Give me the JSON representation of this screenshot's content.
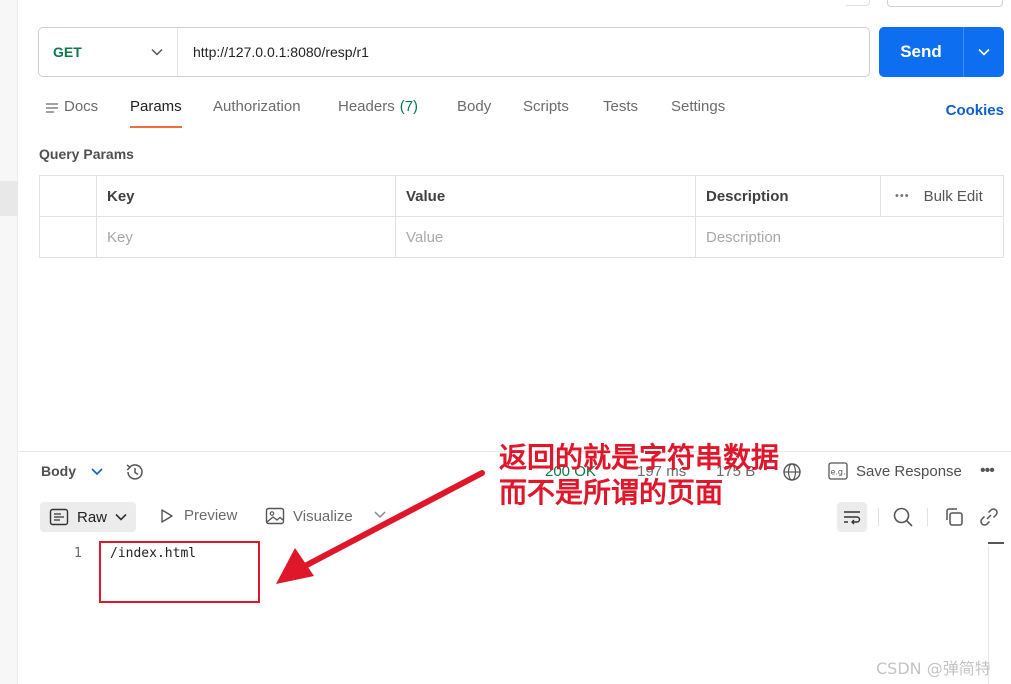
{
  "request": {
    "method": "GET",
    "url": "http://127.0.0.1:8080/resp/r1",
    "send_label": "Send"
  },
  "tabs": {
    "docs": "Docs",
    "params": "Params",
    "authorization": "Authorization",
    "headers": "Headers",
    "headers_count": "(7)",
    "body": "Body",
    "scripts": "Scripts",
    "tests": "Tests",
    "settings": "Settings",
    "active": "Params",
    "cookies": "Cookies"
  },
  "query_params": {
    "title": "Query Params",
    "columns": [
      "Key",
      "Value",
      "Description"
    ],
    "placeholders": [
      "Key",
      "Value",
      "Description"
    ],
    "bulk_edit": "Bulk Edit"
  },
  "response": {
    "body_label": "Body",
    "status": "200 OK",
    "time": "197 ms",
    "size": "175 B",
    "save_response": "Save Response",
    "view_modes": {
      "raw": "Raw",
      "preview": "Preview",
      "visualize": "Visualize"
    },
    "lines": [
      {
        "number": "1",
        "text": "/index.html"
      }
    ]
  },
  "annotation": {
    "line1": "返回的就是字符串数据",
    "line2": "而不是所谓的页面",
    "color": "#e0162b"
  },
  "watermark": "CSDN @弹简特",
  "colors": {
    "accent": "#0d6ef0",
    "method_get": "#0b7a4b",
    "active_tab_underline": "#f26b3a",
    "status_ok": "#0b7a4b",
    "cookies_link": "#0d5fc9"
  }
}
